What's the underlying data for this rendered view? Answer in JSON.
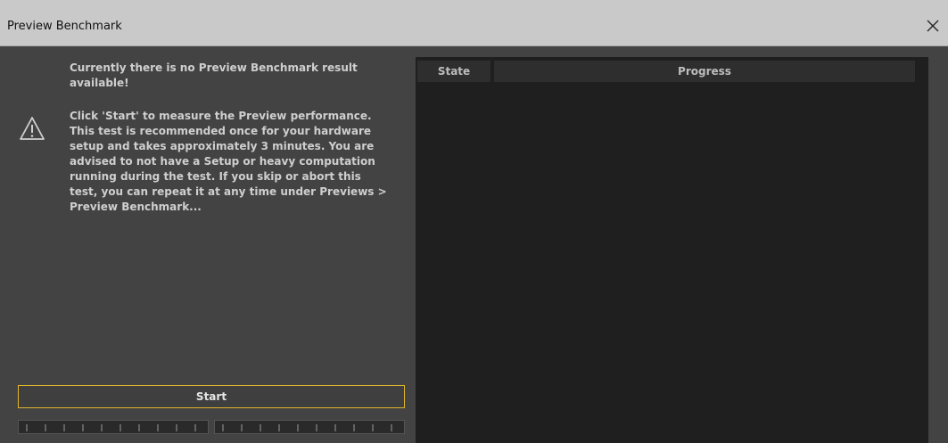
{
  "window": {
    "title": "Preview Benchmark",
    "close_icon": "close-icon"
  },
  "info": {
    "icon": "warning-triangle-icon",
    "message_1": "Currently there is no Preview Benchmark result\navailable!",
    "message_2": "Click 'Start' to measure the Preview performance.\nThis test is recommended once for your hardware\nsetup and takes approximately 3 minutes. You are\nadvised to not have a Setup or heavy computation\nrunning during the test. If you skip or abort this\ntest, you can repeat it at any time under Previews >\nPreview Benchmark..."
  },
  "controls": {
    "start_label": "Start",
    "start_border_color": "#e0b52a"
  },
  "table": {
    "columns": [
      "State",
      "Progress"
    ],
    "rows": []
  }
}
